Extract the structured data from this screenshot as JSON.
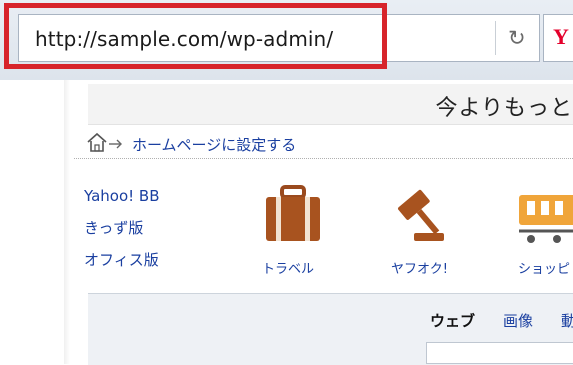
{
  "address_bar": {
    "url": "http://sample.com/wp-admin/",
    "refresh_icon": "refresh-icon",
    "highlight_color": "#d7242b"
  },
  "browser_tab": {
    "logo_letter": "Y"
  },
  "banner": {
    "text": "今よりもっと"
  },
  "home_link": {
    "label": "ホームページに設定する",
    "icon": "home-arrow-icon"
  },
  "side_links": [
    "Yahoo! BB",
    "きっず版",
    "オフィス版"
  ],
  "services": [
    {
      "label": "トラベル",
      "icon": "suitcase-icon"
    },
    {
      "label": "ヤフオク!",
      "icon": "gavel-icon"
    },
    {
      "label": "ショッピ",
      "icon": "cart-icon"
    }
  ],
  "search_tabs": {
    "web": "ウェブ",
    "image": "画像",
    "more": "動"
  },
  "colors": {
    "brand_red": "#e4002b",
    "link_blue": "#1a3fa0",
    "icon_brown": "#9a4a1e"
  }
}
